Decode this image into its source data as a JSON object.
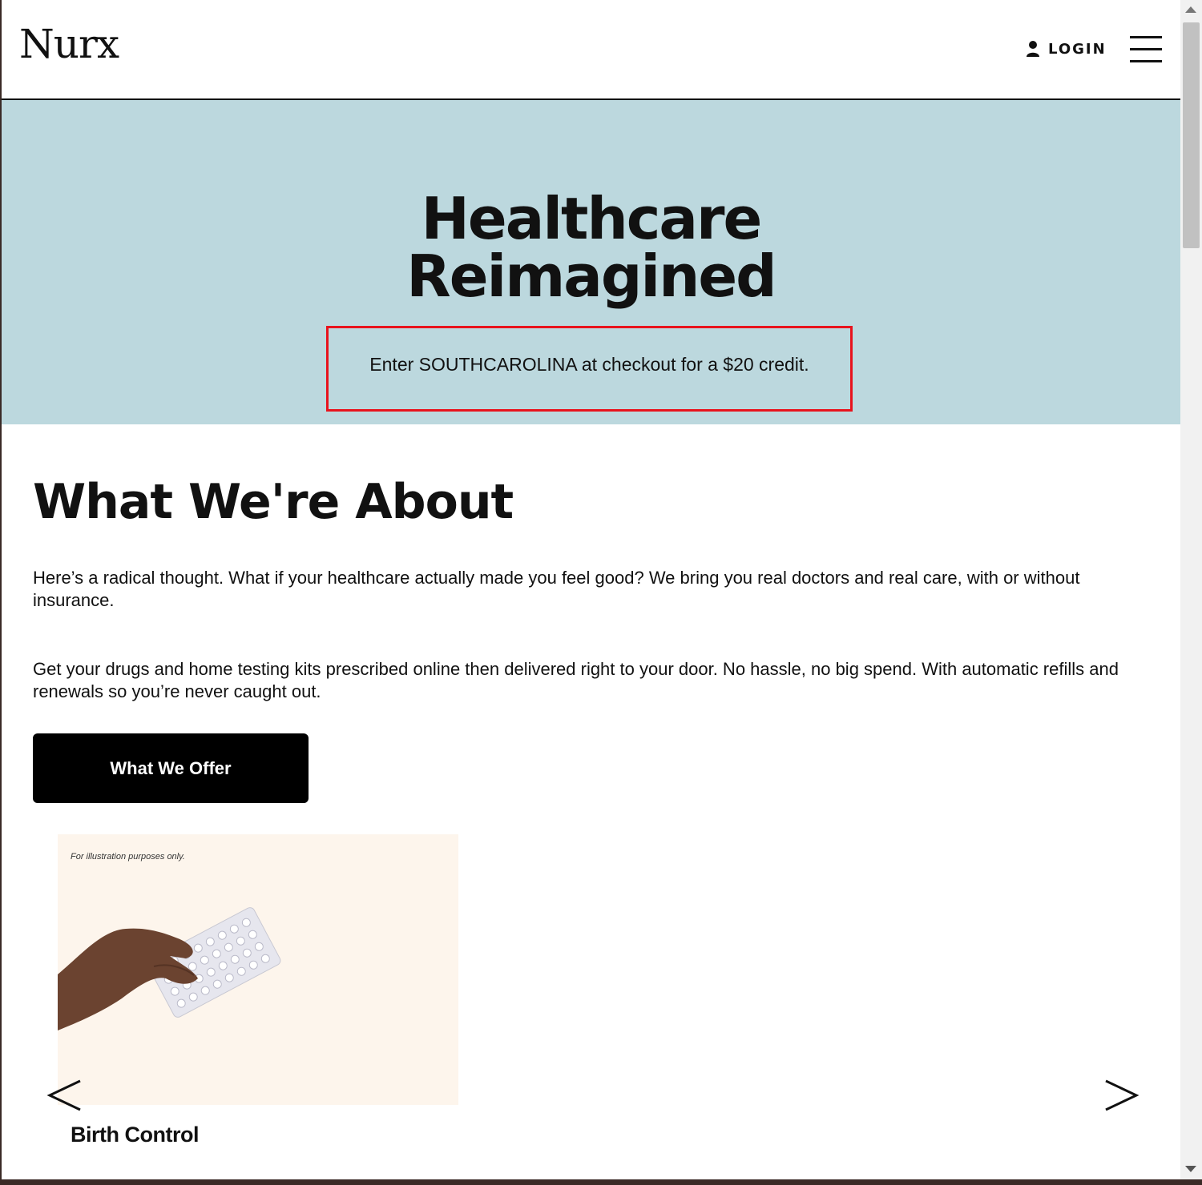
{
  "header": {
    "logo": "Nurx",
    "login_label": "LOGIN"
  },
  "hero": {
    "title_line1": "Healthcare",
    "title_line2": "Reimagined",
    "promo_text": "Enter SOUTHCAROLINA at checkout for a $20 credit.",
    "background_color": "#bcd8de",
    "promo_border_color": "#e8131d"
  },
  "about": {
    "title": "What We're About",
    "paragraph1": "Here’s a radical thought. What if your healthcare actually made you feel good? We bring you real doctors and real care, with or without insurance.",
    "paragraph2": "Get your drugs and home testing kits prescribed online then delivered right to your door. No hassle, no big spend. With automatic refills and renewals so you’re never caught out.",
    "cta_label": "What We Offer"
  },
  "carousel": {
    "items": [
      {
        "note": "For illustration purposes only.",
        "caption": "Birth Control",
        "image": "hand-holding-pill-pack"
      }
    ],
    "prev_icon": "chevron-left-icon",
    "next_icon": "chevron-right-icon"
  }
}
